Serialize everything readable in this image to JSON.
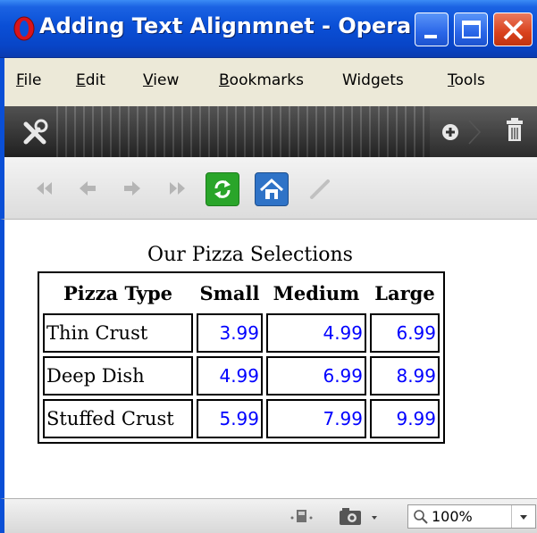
{
  "window": {
    "title": "Adding Text Alignmnet - Opera"
  },
  "menu": [
    {
      "label": "File",
      "accel": "F",
      "rest": "ile"
    },
    {
      "label": "Edit",
      "accel": "E",
      "rest": "dit"
    },
    {
      "label": "View",
      "accel": "V",
      "rest": "iew"
    },
    {
      "label": "Bookmarks",
      "accel": "B",
      "rest": "ookmarks"
    },
    {
      "label": "Widgets",
      "accel": "",
      "rest": "Widgets"
    },
    {
      "label": "Tools",
      "accel": "T",
      "rest": "ools"
    }
  ],
  "toolbar_icons": [
    "wrench-icon",
    "add-icon",
    "trash-icon",
    "rewind-icon",
    "back-icon",
    "forward-icon",
    "fast-forward-icon",
    "reload-icon",
    "home-icon",
    "edit-icon"
  ],
  "page": {
    "caption": "Our Pizza Selections",
    "headers": [
      "Pizza Type",
      "Small",
      "Medium",
      "Large"
    ],
    "rows": [
      {
        "name": "Thin Crust",
        "small": "3.99",
        "medium": "4.99",
        "large": "6.99"
      },
      {
        "name": "Deep Dish",
        "small": "4.99",
        "medium": "6.99",
        "large": "8.99"
      },
      {
        "name": "Stuffed Crust",
        "small": "5.99",
        "medium": "7.99",
        "large": "9.99"
      }
    ]
  },
  "status": {
    "zoom": "100%"
  },
  "colors": {
    "titlebar": "#0a4fd6",
    "price_text": "#0000ff",
    "reload_button": "#2aa52a",
    "home_button": "#2f73c7"
  }
}
